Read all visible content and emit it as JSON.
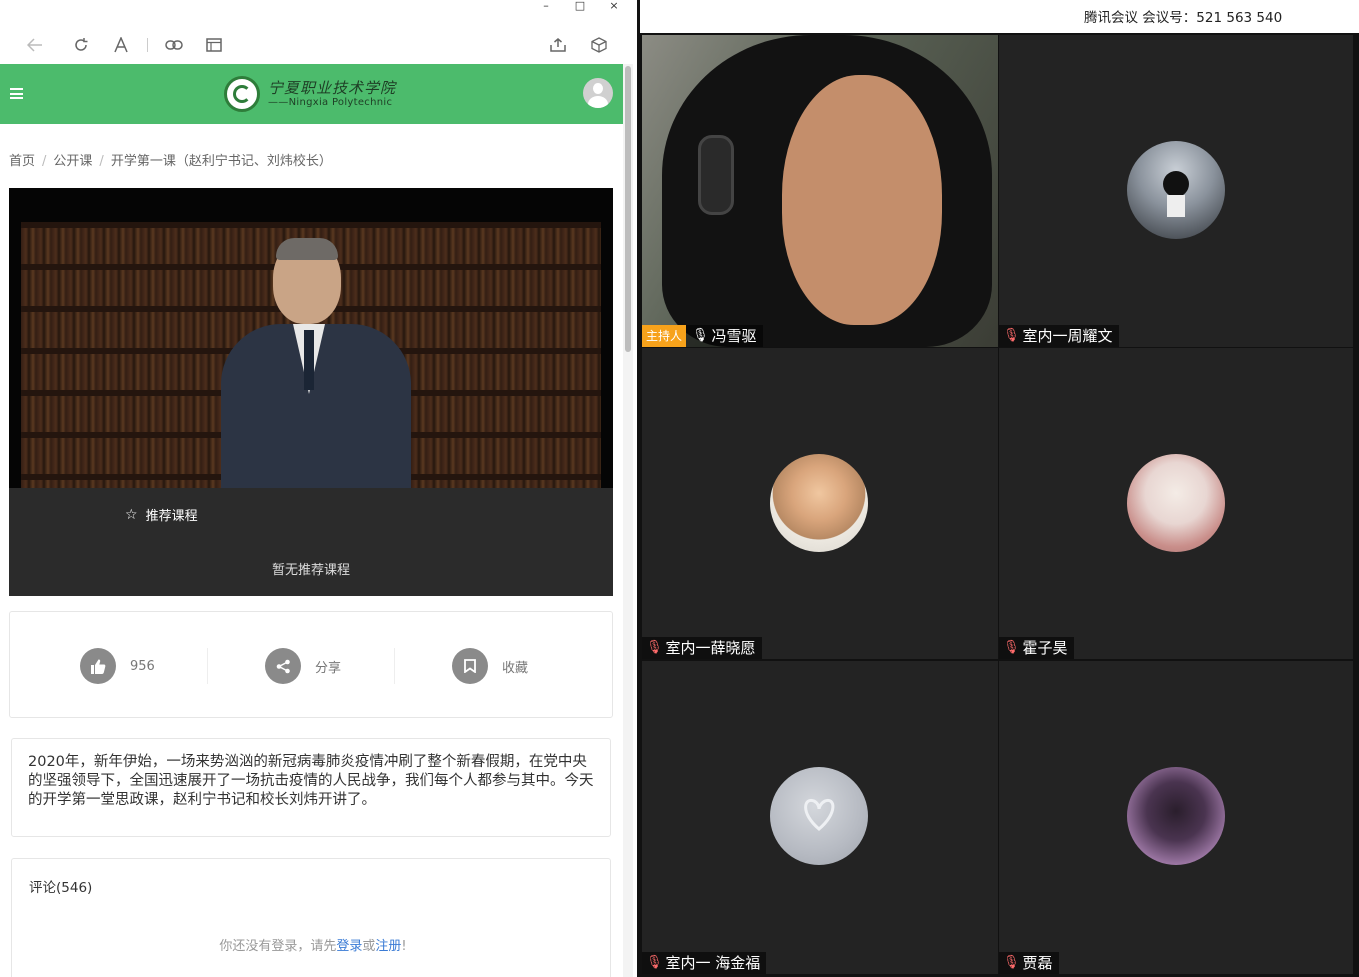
{
  "browser": {
    "window_controls": [
      "–",
      "□",
      "×"
    ],
    "toolbar_icons": [
      "back-icon",
      "refresh-icon",
      "font-icon",
      "link-icon",
      "reader-icon",
      "share-icon",
      "cube-icon"
    ]
  },
  "site": {
    "logo_cn": "宁夏职业技术学院",
    "logo_en": "——Ningxia Polytechnic"
  },
  "breadcrumb": {
    "items": [
      "首页",
      "公开课",
      "开学第一课（赵利宁书记、刘炜校长）"
    ],
    "separator": "/"
  },
  "recommend": {
    "title": "推荐课程",
    "empty": "暂无推荐课程"
  },
  "actions": {
    "like_count": "956",
    "share": "分享",
    "favorite": "收藏"
  },
  "description": "2020年，新年伊始，一场来势汹汹的新冠病毒肺炎疫情冲刷了整个新春假期，在党中央的坚强领导下，全国迅速展开了一场抗击疫情的人民战争，我们每个人都参与其中。今天的开学第一堂思政课，赵利宁书记和校长刘炜开讲了。",
  "comments": {
    "title": "评论(546)",
    "login_prefix": "你还没有登录，请先",
    "login": "登录",
    "or": "或",
    "register": "注册",
    "suffix": "!"
  },
  "meeting": {
    "title": "腾讯会议 会议号：521 563 540",
    "host_badge": "主持人",
    "participants": [
      {
        "name": "冯雪驱",
        "muted": false,
        "host": true
      },
      {
        "name": "室内一周耀文",
        "muted": true,
        "host": false
      },
      {
        "name": "室内一薛晓愿",
        "muted": true,
        "host": false
      },
      {
        "name": "霍子昊",
        "muted": true,
        "host": false
      },
      {
        "name": "室内一  海金福",
        "muted": true,
        "host": false
      },
      {
        "name": "贾磊",
        "muted": true,
        "host": false
      }
    ]
  },
  "colors": {
    "site_green": "#4cbb6c",
    "host_badge": "#f7a21b",
    "link_blue": "#3a7bd5"
  }
}
